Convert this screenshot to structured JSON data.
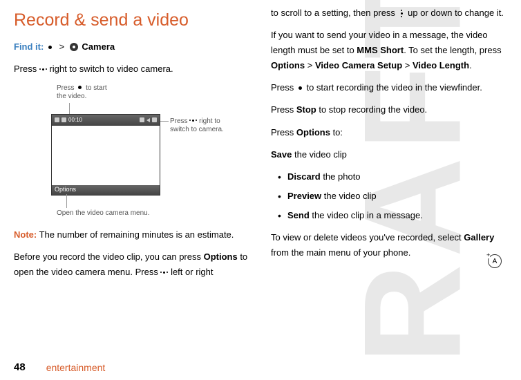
{
  "watermark": "RAFT",
  "left": {
    "title": "Record & send a video",
    "findit_label": "Find it:",
    "findit_sep": ">",
    "findit_target": "Camera",
    "p1_a": "Press ",
    "p1_b": " right to switch to video camera.",
    "callout1_a": "Press ",
    "callout1_b": " to start the video.",
    "callout2_a": "Press ",
    "callout2_b": " right to switch to camera.",
    "callout3": "Open the video camera menu.",
    "vf_time": "00:10",
    "vf_options": "Options",
    "note_label": "Note:",
    "note_text": " The number of remaining minutes is an estimate.",
    "p2_a": "Before you record the video clip, you can press ",
    "p2_b": "Options",
    "p2_c": " to open the video camera menu. Press ",
    "p2_d": " left or right"
  },
  "right": {
    "p1_a": "to scroll to a setting, then press ",
    "p1_b": " up or down to change it.",
    "p2_a": "If you want to send your video in a message, the video length must be set to ",
    "p2_b": "MMS Short",
    "p2_c": ". To set the length, press ",
    "p2_d": "Options",
    "p2_e": " > ",
    "p2_f": "Video Camera Setup",
    "p2_g": " > ",
    "p2_h": "Video Length",
    "p2_i": ".",
    "p3_a": "Press ",
    "p3_b": " to start recording the video in the viewfinder.",
    "p4_a": "Press ",
    "p4_b": "Stop",
    "p4_c": " to stop recording the video.",
    "p5_a": "Press ",
    "p5_b": "Options",
    "p5_c": " to:",
    "p6_a": "Save",
    "p6_b": " the video clip",
    "bullets": [
      {
        "b": "Discard",
        "t": " the photo"
      },
      {
        "b": "Preview",
        "t": " the video clip"
      },
      {
        "b": "Send",
        "t": " the video clip in a message."
      }
    ],
    "p7_a": "To view or delete videos you've recorded, select ",
    "p7_b": "Gallery",
    "p7_c": " from the main menu of your phone."
  },
  "footer": {
    "page": "48",
    "section": "entertainment"
  },
  "ea": "A"
}
